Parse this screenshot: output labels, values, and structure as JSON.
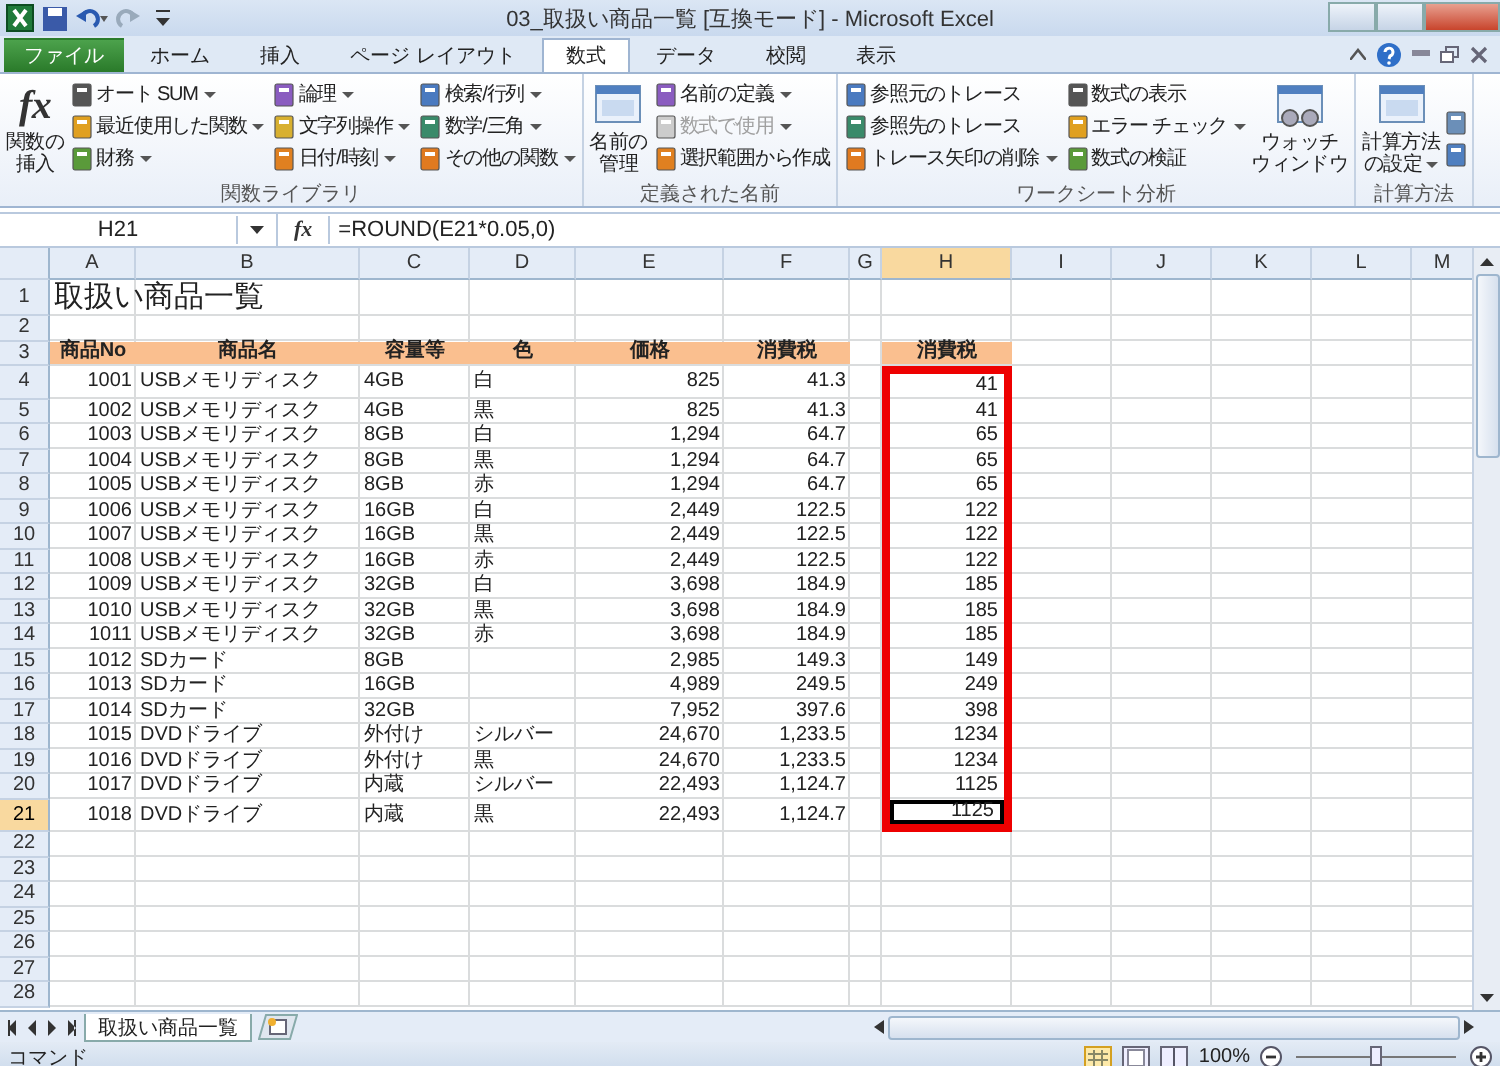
{
  "window": {
    "title": "03_取扱い商品一覧  [互換モード]  -  Microsoft Excel"
  },
  "tabs": [
    {
      "label": "ファイル",
      "kind": "file",
      "selected": false
    },
    {
      "label": "ホーム",
      "kind": "tab",
      "selected": false
    },
    {
      "label": "挿入",
      "kind": "tab",
      "selected": false
    },
    {
      "label": "ページ レイアウト",
      "kind": "tab",
      "selected": false
    },
    {
      "label": "数式",
      "kind": "tab",
      "selected": true
    },
    {
      "label": "データ",
      "kind": "tab",
      "selected": false
    },
    {
      "label": "校閲",
      "kind": "tab",
      "selected": false
    },
    {
      "label": "表示",
      "kind": "tab",
      "selected": false
    }
  ],
  "ribbon": {
    "groups": [
      {
        "label": "関数ライブラリ",
        "large": [
          {
            "glyph": "fx",
            "lines": [
              "関数の",
              "挿入"
            ],
            "dropdown": false
          }
        ],
        "small": [
          {
            "label": "オート SUM",
            "dropdown": true,
            "disabled": false
          },
          {
            "label": "最近使用した関数",
            "dropdown": true,
            "disabled": false
          },
          {
            "label": "財務",
            "dropdown": true,
            "disabled": false
          },
          {
            "label": "論理",
            "dropdown": true,
            "disabled": false
          },
          {
            "label": "文字列操作",
            "dropdown": true,
            "disabled": false
          },
          {
            "label": "日付/時刻",
            "dropdown": true,
            "disabled": false
          },
          {
            "label": "検索/行列",
            "dropdown": true,
            "disabled": false
          },
          {
            "label": "数学/三角",
            "dropdown": true,
            "disabled": false
          },
          {
            "label": "その他の関数",
            "dropdown": true,
            "disabled": false
          }
        ]
      },
      {
        "label": "定義された名前",
        "large": [
          {
            "lines": [
              "名前の",
              "管理"
            ],
            "dropdown": false
          }
        ],
        "small": [
          {
            "label": "名前の定義",
            "dropdown": true,
            "disabled": false
          },
          {
            "label": "数式で使用",
            "dropdown": true,
            "disabled": true
          },
          {
            "label": "選択範囲から作成",
            "dropdown": false,
            "disabled": false
          }
        ]
      },
      {
        "label": "ワークシート分析",
        "small": [
          {
            "label": "参照元のトレース",
            "dropdown": false,
            "disabled": false
          },
          {
            "label": "参照先のトレース",
            "dropdown": false,
            "disabled": false
          },
          {
            "label": "トレース矢印の削除",
            "dropdown": true,
            "disabled": false
          },
          {
            "label": "数式の表示",
            "dropdown": false,
            "disabled": false
          },
          {
            "label": "エラー チェック",
            "dropdown": true,
            "disabled": false
          },
          {
            "label": "数式の検証",
            "dropdown": false,
            "disabled": false
          }
        ],
        "after": [
          {
            "lines": [
              "ウォッチ",
              "ウィンドウ"
            ],
            "dropdown": false
          }
        ]
      },
      {
        "label": "計算方法",
        "large": [
          {
            "lines": [
              "計算方法",
              "の設定"
            ],
            "dropdown": true
          }
        ]
      }
    ]
  },
  "formula_bar": {
    "name_box": "H21",
    "glyph": "fx",
    "formula": "=ROUND(E21*0.05,0)"
  },
  "sheet": {
    "columns": [
      {
        "label": "A",
        "selected": false
      },
      {
        "label": "B",
        "selected": false
      },
      {
        "label": "C",
        "selected": false
      },
      {
        "label": "D",
        "selected": false
      },
      {
        "label": "E",
        "selected": false
      },
      {
        "label": "F",
        "selected": false
      },
      {
        "label": "G",
        "selected": false
      },
      {
        "label": "H",
        "selected": true
      },
      {
        "label": "I",
        "selected": false
      },
      {
        "label": "J",
        "selected": false
      },
      {
        "label": "K",
        "selected": false
      },
      {
        "label": "L",
        "selected": false
      },
      {
        "label": "M",
        "selected": false
      }
    ],
    "rows": [
      {
        "number": "1",
        "kind": "title",
        "selected": false,
        "text": "取扱い商品一覧"
      },
      {
        "number": "2",
        "kind": "empty",
        "selected": false
      },
      {
        "number": "3",
        "kind": "header",
        "selected": false,
        "cells": {
          "a": "商品No",
          "b": "商品名",
          "c": "容量等",
          "d": "色",
          "e": "価格",
          "f": "消費税",
          "h": "消費税"
        }
      },
      {
        "number": "4",
        "kind": "data",
        "selected": false,
        "highlighted": true,
        "cells": {
          "a": "1001",
          "b": "USBメモリディスク",
          "c": "4GB",
          "d": "白",
          "e": "825",
          "f": "41.3",
          "h": "41"
        }
      },
      {
        "number": "5",
        "kind": "data",
        "selected": false,
        "highlighted": true,
        "cells": {
          "a": "1002",
          "b": "USBメモリディスク",
          "c": "4GB",
          "d": "黒",
          "e": "825",
          "f": "41.3",
          "h": "41"
        }
      },
      {
        "number": "6",
        "kind": "data",
        "selected": false,
        "highlighted": true,
        "cells": {
          "a": "1003",
          "b": "USBメモリディスク",
          "c": "8GB",
          "d": "白",
          "e": "1,294",
          "f": "64.7",
          "h": "65"
        }
      },
      {
        "number": "7",
        "kind": "data",
        "selected": false,
        "highlighted": true,
        "cells": {
          "a": "1004",
          "b": "USBメモリディスク",
          "c": "8GB",
          "d": "黒",
          "e": "1,294",
          "f": "64.7",
          "h": "65"
        }
      },
      {
        "number": "8",
        "kind": "data",
        "selected": false,
        "highlighted": true,
        "cells": {
          "a": "1005",
          "b": "USBメモリディスク",
          "c": "8GB",
          "d": "赤",
          "e": "1,294",
          "f": "64.7",
          "h": "65"
        }
      },
      {
        "number": "9",
        "kind": "data",
        "selected": false,
        "highlighted": true,
        "cells": {
          "a": "1006",
          "b": "USBメモリディスク",
          "c": "16GB",
          "d": "白",
          "e": "2,449",
          "f": "122.5",
          "h": "122"
        }
      },
      {
        "number": "10",
        "kind": "data",
        "selected": false,
        "highlighted": true,
        "cells": {
          "a": "1007",
          "b": "USBメモリディスク",
          "c": "16GB",
          "d": "黒",
          "e": "2,449",
          "f": "122.5",
          "h": "122"
        }
      },
      {
        "number": "11",
        "kind": "data",
        "selected": false,
        "highlighted": true,
        "cells": {
          "a": "1008",
          "b": "USBメモリディスク",
          "c": "16GB",
          "d": "赤",
          "e": "2,449",
          "f": "122.5",
          "h": "122"
        }
      },
      {
        "number": "12",
        "kind": "data",
        "selected": false,
        "highlighted": true,
        "cells": {
          "a": "1009",
          "b": "USBメモリディスク",
          "c": "32GB",
          "d": "白",
          "e": "3,698",
          "f": "184.9",
          "h": "185"
        }
      },
      {
        "number": "13",
        "kind": "data",
        "selected": false,
        "highlighted": true,
        "cells": {
          "a": "1010",
          "b": "USBメモリディスク",
          "c": "32GB",
          "d": "黒",
          "e": "3,698",
          "f": "184.9",
          "h": "185"
        }
      },
      {
        "number": "14",
        "kind": "data",
        "selected": false,
        "highlighted": true,
        "cells": {
          "a": "1011",
          "b": "USBメモリディスク",
          "c": "32GB",
          "d": "赤",
          "e": "3,698",
          "f": "184.9",
          "h": "185"
        }
      },
      {
        "number": "15",
        "kind": "data",
        "selected": false,
        "highlighted": true,
        "cells": {
          "a": "1012",
          "b": "SDカード",
          "c": "8GB",
          "e": "2,985",
          "f": "149.3",
          "h": "149"
        }
      },
      {
        "number": "16",
        "kind": "data",
        "selected": false,
        "highlighted": true,
        "cells": {
          "a": "1013",
          "b": "SDカード",
          "c": "16GB",
          "e": "4,989",
          "f": "249.5",
          "h": "249"
        }
      },
      {
        "number": "17",
        "kind": "data",
        "selected": false,
        "highlighted": true,
        "cells": {
          "a": "1014",
          "b": "SDカード",
          "c": "32GB",
          "e": "7,952",
          "f": "397.6",
          "h": "398"
        }
      },
      {
        "number": "18",
        "kind": "data",
        "selected": false,
        "highlighted": true,
        "cells": {
          "a": "1015",
          "b": "DVDドライブ",
          "c": "外付け",
          "d": "シルバー",
          "e": "24,670",
          "f": "1,233.5",
          "h": "1234"
        }
      },
      {
        "number": "19",
        "kind": "data",
        "selected": false,
        "highlighted": true,
        "cells": {
          "a": "1016",
          "b": "DVDドライブ",
          "c": "外付け",
          "d": "黒",
          "e": "24,670",
          "f": "1,233.5",
          "h": "1234"
        }
      },
      {
        "number": "20",
        "kind": "data",
        "selected": false,
        "highlighted": true,
        "cells": {
          "a": "1017",
          "b": "DVDドライブ",
          "c": "内蔵",
          "d": "シルバー",
          "e": "22,493",
          "f": "1,124.7",
          "h": "1125"
        }
      },
      {
        "number": "21",
        "kind": "data",
        "selected": true,
        "highlighted": true,
        "cells": {
          "a": "1018",
          "b": "DVDドライブ",
          "c": "内蔵",
          "d": "黒",
          "e": "22,493",
          "f": "1,124.7",
          "h": "1125"
        }
      },
      {
        "number": "22",
        "kind": "empty",
        "selected": false
      },
      {
        "number": "23",
        "kind": "empty",
        "selected": false
      },
      {
        "number": "24",
        "kind": "empty",
        "selected": false
      },
      {
        "number": "25",
        "kind": "empty",
        "selected": false
      },
      {
        "number": "26",
        "kind": "empty",
        "selected": false
      },
      {
        "number": "27",
        "kind": "empty",
        "selected": false
      },
      {
        "number": "28",
        "kind": "empty",
        "selected": false
      }
    ]
  },
  "sheet_tabs": [
    {
      "label": "取扱い商品一覧",
      "selected": true
    }
  ],
  "status_bar": {
    "mode": "コマンド",
    "zoom": "100%",
    "zoom_slider": {
      "level": 0.5
    }
  }
}
